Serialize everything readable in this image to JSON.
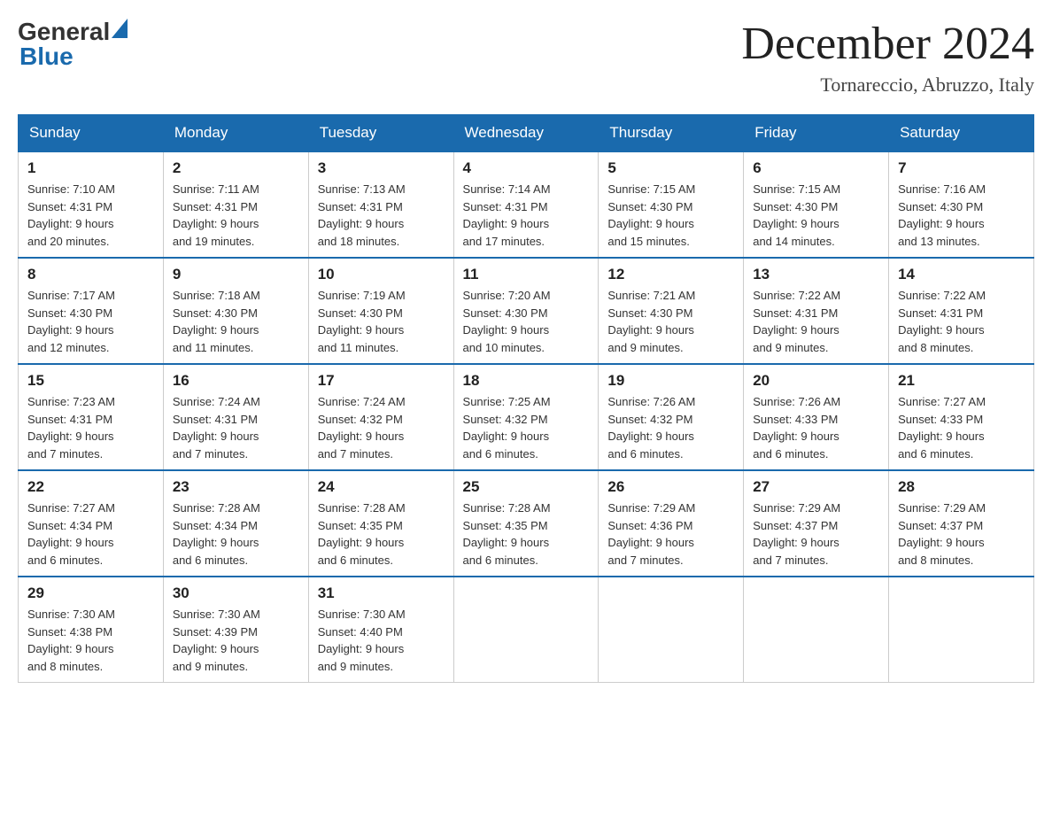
{
  "logo": {
    "text_general": "General",
    "text_blue": "Blue"
  },
  "title": "December 2024",
  "subtitle": "Tornareccio, Abruzzo, Italy",
  "days_of_week": [
    "Sunday",
    "Monday",
    "Tuesday",
    "Wednesday",
    "Thursday",
    "Friday",
    "Saturday"
  ],
  "weeks": [
    [
      {
        "day": "1",
        "sunrise": "7:10 AM",
        "sunset": "4:31 PM",
        "daylight": "9 hours and 20 minutes."
      },
      {
        "day": "2",
        "sunrise": "7:11 AM",
        "sunset": "4:31 PM",
        "daylight": "9 hours and 19 minutes."
      },
      {
        "day": "3",
        "sunrise": "7:13 AM",
        "sunset": "4:31 PM",
        "daylight": "9 hours and 18 minutes."
      },
      {
        "day": "4",
        "sunrise": "7:14 AM",
        "sunset": "4:31 PM",
        "daylight": "9 hours and 17 minutes."
      },
      {
        "day": "5",
        "sunrise": "7:15 AM",
        "sunset": "4:30 PM",
        "daylight": "9 hours and 15 minutes."
      },
      {
        "day": "6",
        "sunrise": "7:15 AM",
        "sunset": "4:30 PM",
        "daylight": "9 hours and 14 minutes."
      },
      {
        "day": "7",
        "sunrise": "7:16 AM",
        "sunset": "4:30 PM",
        "daylight": "9 hours and 13 minutes."
      }
    ],
    [
      {
        "day": "8",
        "sunrise": "7:17 AM",
        "sunset": "4:30 PM",
        "daylight": "9 hours and 12 minutes."
      },
      {
        "day": "9",
        "sunrise": "7:18 AM",
        "sunset": "4:30 PM",
        "daylight": "9 hours and 11 minutes."
      },
      {
        "day": "10",
        "sunrise": "7:19 AM",
        "sunset": "4:30 PM",
        "daylight": "9 hours and 11 minutes."
      },
      {
        "day": "11",
        "sunrise": "7:20 AM",
        "sunset": "4:30 PM",
        "daylight": "9 hours and 10 minutes."
      },
      {
        "day": "12",
        "sunrise": "7:21 AM",
        "sunset": "4:30 PM",
        "daylight": "9 hours and 9 minutes."
      },
      {
        "day": "13",
        "sunrise": "7:22 AM",
        "sunset": "4:31 PM",
        "daylight": "9 hours and 9 minutes."
      },
      {
        "day": "14",
        "sunrise": "7:22 AM",
        "sunset": "4:31 PM",
        "daylight": "9 hours and 8 minutes."
      }
    ],
    [
      {
        "day": "15",
        "sunrise": "7:23 AM",
        "sunset": "4:31 PM",
        "daylight": "9 hours and 7 minutes."
      },
      {
        "day": "16",
        "sunrise": "7:24 AM",
        "sunset": "4:31 PM",
        "daylight": "9 hours and 7 minutes."
      },
      {
        "day": "17",
        "sunrise": "7:24 AM",
        "sunset": "4:32 PM",
        "daylight": "9 hours and 7 minutes."
      },
      {
        "day": "18",
        "sunrise": "7:25 AM",
        "sunset": "4:32 PM",
        "daylight": "9 hours and 6 minutes."
      },
      {
        "day": "19",
        "sunrise": "7:26 AM",
        "sunset": "4:32 PM",
        "daylight": "9 hours and 6 minutes."
      },
      {
        "day": "20",
        "sunrise": "7:26 AM",
        "sunset": "4:33 PM",
        "daylight": "9 hours and 6 minutes."
      },
      {
        "day": "21",
        "sunrise": "7:27 AM",
        "sunset": "4:33 PM",
        "daylight": "9 hours and 6 minutes."
      }
    ],
    [
      {
        "day": "22",
        "sunrise": "7:27 AM",
        "sunset": "4:34 PM",
        "daylight": "9 hours and 6 minutes."
      },
      {
        "day": "23",
        "sunrise": "7:28 AM",
        "sunset": "4:34 PM",
        "daylight": "9 hours and 6 minutes."
      },
      {
        "day": "24",
        "sunrise": "7:28 AM",
        "sunset": "4:35 PM",
        "daylight": "9 hours and 6 minutes."
      },
      {
        "day": "25",
        "sunrise": "7:28 AM",
        "sunset": "4:35 PM",
        "daylight": "9 hours and 6 minutes."
      },
      {
        "day": "26",
        "sunrise": "7:29 AM",
        "sunset": "4:36 PM",
        "daylight": "9 hours and 7 minutes."
      },
      {
        "day": "27",
        "sunrise": "7:29 AM",
        "sunset": "4:37 PM",
        "daylight": "9 hours and 7 minutes."
      },
      {
        "day": "28",
        "sunrise": "7:29 AM",
        "sunset": "4:37 PM",
        "daylight": "9 hours and 8 minutes."
      }
    ],
    [
      {
        "day": "29",
        "sunrise": "7:30 AM",
        "sunset": "4:38 PM",
        "daylight": "9 hours and 8 minutes."
      },
      {
        "day": "30",
        "sunrise": "7:30 AM",
        "sunset": "4:39 PM",
        "daylight": "9 hours and 9 minutes."
      },
      {
        "day": "31",
        "sunrise": "7:30 AM",
        "sunset": "4:40 PM",
        "daylight": "9 hours and 9 minutes."
      },
      null,
      null,
      null,
      null
    ]
  ]
}
